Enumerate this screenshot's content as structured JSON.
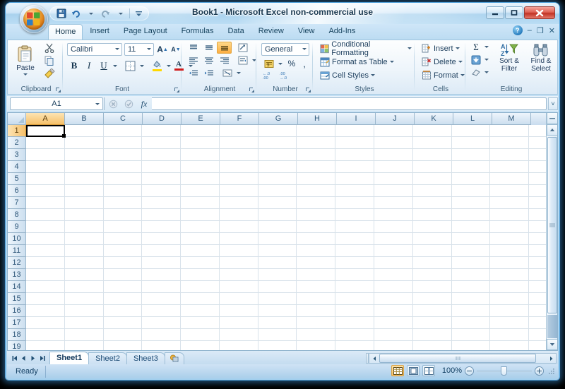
{
  "window": {
    "title": "Book1 - Microsoft Excel non-commercial use",
    "controls": {
      "minimize": "–",
      "restore": "❐",
      "close": "✕"
    }
  },
  "quick_access": {
    "items": [
      {
        "name": "office-button",
        "label": "Office"
      },
      {
        "name": "save-button",
        "label": "Save"
      },
      {
        "name": "undo-button",
        "label": "Undo"
      },
      {
        "name": "redo-button",
        "label": "Redo"
      },
      {
        "name": "customize-qat-button",
        "label": "Customize Quick Access Toolbar"
      }
    ]
  },
  "tabs": {
    "items": [
      "Home",
      "Insert",
      "Page Layout",
      "Formulas",
      "Data",
      "Review",
      "View",
      "Add-Ins"
    ],
    "active": "Home",
    "right_controls": {
      "help": "?",
      "minimize_ribbon": "–",
      "restore_window": "❐",
      "close_window": "✕"
    }
  },
  "ribbon": {
    "groups": [
      {
        "name": "Clipboard",
        "label": "Clipboard",
        "buttons": [
          {
            "name": "paste-button",
            "label": "Paste"
          },
          {
            "name": "cut-button",
            "label": "Cut"
          },
          {
            "name": "copy-button",
            "label": "Copy"
          },
          {
            "name": "format-painter-button",
            "label": "Format Painter"
          },
          {
            "name": "clipboard-dialog-launcher",
            "label": "Clipboard Dialog Box Launcher"
          }
        ]
      },
      {
        "name": "Font",
        "label": "Font",
        "font_name": "Calibri",
        "font_size": "11",
        "buttons": [
          {
            "name": "grow-font-button",
            "label": "A˄"
          },
          {
            "name": "shrink-font-button",
            "label": "A˅"
          },
          {
            "name": "bold-button",
            "label": "B"
          },
          {
            "name": "italic-button",
            "label": "I"
          },
          {
            "name": "underline-button",
            "label": "U"
          },
          {
            "name": "borders-button",
            "label": "Borders"
          },
          {
            "name": "fill-color-button",
            "label": "Fill Color"
          },
          {
            "name": "font-color-button",
            "label": "Font Color"
          },
          {
            "name": "font-dialog-launcher",
            "label": "Font Dialog Box Launcher"
          }
        ]
      },
      {
        "name": "Alignment",
        "label": "Alignment",
        "buttons": [
          {
            "name": "align-top-button",
            "label": "Top Align"
          },
          {
            "name": "align-middle-button",
            "label": "Middle Align"
          },
          {
            "name": "align-bottom-button",
            "label": "Bottom Align"
          },
          {
            "name": "orientation-button",
            "label": "Orientation"
          },
          {
            "name": "align-left-button",
            "label": "Align Text Left"
          },
          {
            "name": "align-center-button",
            "label": "Center"
          },
          {
            "name": "align-right-button",
            "label": "Align Text Right"
          },
          {
            "name": "wrap-text-button",
            "label": "Wrap Text"
          },
          {
            "name": "decrease-indent-button",
            "label": "Decrease Indent"
          },
          {
            "name": "increase-indent-button",
            "label": "Increase Indent"
          },
          {
            "name": "merge-and-center-button",
            "label": "Merge & Center"
          },
          {
            "name": "alignment-dialog-launcher",
            "label": "Alignment Dialog Box Launcher"
          }
        ]
      },
      {
        "name": "Number",
        "label": "Number",
        "format": "General",
        "buttons": [
          {
            "name": "accounting-format-button",
            "label": "Accounting Number Format"
          },
          {
            "name": "percent-style-button",
            "label": "%"
          },
          {
            "name": "comma-style-button",
            "label": ","
          },
          {
            "name": "increase-decimal-button",
            "label": "Increase Decimal"
          },
          {
            "name": "decrease-decimal-button",
            "label": "Decrease Decimal"
          },
          {
            "name": "number-dialog-launcher",
            "label": "Number Dialog Box Launcher"
          }
        ]
      },
      {
        "name": "Styles",
        "label": "Styles",
        "buttons": [
          {
            "name": "conditional-formatting-button",
            "label": "Conditional Formatting"
          },
          {
            "name": "format-as-table-button",
            "label": "Format as Table"
          },
          {
            "name": "cell-styles-button",
            "label": "Cell Styles"
          }
        ]
      },
      {
        "name": "Cells",
        "label": "Cells",
        "buttons": [
          {
            "name": "insert-cells-button",
            "label": "Insert"
          },
          {
            "name": "delete-cells-button",
            "label": "Delete"
          },
          {
            "name": "format-cells-button",
            "label": "Format"
          }
        ]
      },
      {
        "name": "Editing",
        "label": "Editing",
        "buttons": [
          {
            "name": "autosum-button",
            "label": "Σ"
          },
          {
            "name": "fill-button",
            "label": "Fill"
          },
          {
            "name": "clear-button",
            "label": "Clear"
          },
          {
            "name": "sort-and-filter-button",
            "label": "Sort &\nFilter"
          },
          {
            "name": "sort-and-filter-line1",
            "label": "Sort &"
          },
          {
            "name": "sort-and-filter-line2",
            "label": "Filter"
          },
          {
            "name": "find-and-select-line1",
            "label": "Find &"
          },
          {
            "name": "find-and-select-line2",
            "label": "Select"
          }
        ]
      }
    ]
  },
  "formula_bar": {
    "name_box": "A1",
    "formula_value": "",
    "cancel_label": "✕",
    "enter_label": "✓",
    "insert_function_label": "fx",
    "expand_label": "˅"
  },
  "grid": {
    "columns": [
      "A",
      "B",
      "C",
      "D",
      "E",
      "F",
      "G",
      "H",
      "I",
      "J",
      "K",
      "L",
      "M"
    ],
    "rows": [
      "1",
      "2",
      "3",
      "4",
      "5",
      "6",
      "7",
      "8",
      "9",
      "10",
      "11",
      "12",
      "13",
      "14",
      "15",
      "16",
      "17",
      "18",
      "19"
    ],
    "selected_cell": "A1",
    "selected_column": "A",
    "selected_row": "1",
    "cell_values": []
  },
  "sheet_tabs": {
    "items": [
      "Sheet1",
      "Sheet2",
      "Sheet3"
    ],
    "active": "Sheet1",
    "insert_sheet_label": "Insert Worksheet",
    "nav": {
      "first": "◀┃",
      "prev": "◀",
      "next": "▶",
      "last": "┃▶"
    }
  },
  "status_bar": {
    "mode": "Ready",
    "zoom": "100%",
    "views": [
      {
        "name": "normal-view-button",
        "label": "Normal",
        "active": true
      },
      {
        "name": "page-layout-view-button",
        "label": "Page Layout",
        "active": false
      },
      {
        "name": "page-break-preview-button",
        "label": "Page Break Preview",
        "active": false
      }
    ],
    "zoom_out_label": "Zoom Out",
    "zoom_in_label": "Zoom In"
  }
}
